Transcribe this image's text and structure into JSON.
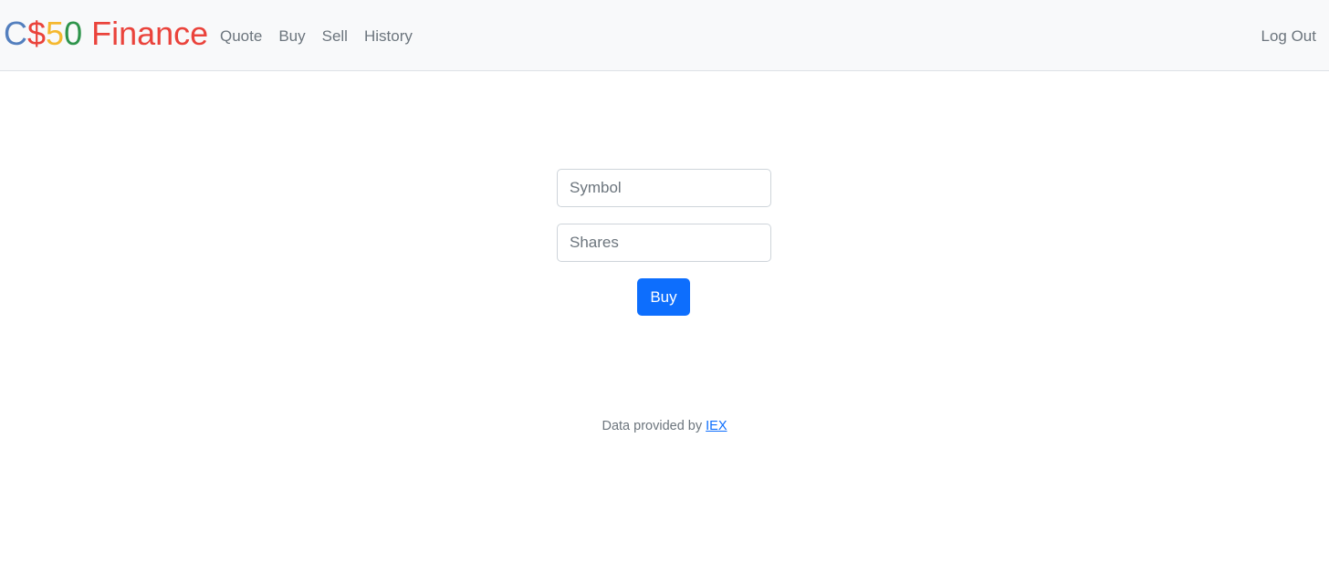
{
  "brand": {
    "c": "C",
    "dollar": "$",
    "five": "5",
    "zero": "0",
    "finance": " Finance",
    "colors": {
      "c": "#537fbe",
      "dollar": "#ea433b",
      "five": "#f5b82e",
      "zero": "#2e944b",
      "finance": "#ea433b"
    }
  },
  "nav": {
    "items": [
      {
        "label": "Quote"
      },
      {
        "label": "Buy"
      },
      {
        "label": "Sell"
      },
      {
        "label": "History"
      }
    ],
    "logout_label": "Log Out"
  },
  "form": {
    "symbol": {
      "value": "",
      "placeholder": "Symbol"
    },
    "shares": {
      "value": "",
      "placeholder": "Shares"
    },
    "submit_label": "Buy",
    "accent_color": "#0d6efd"
  },
  "footer": {
    "text": "Data provided by ",
    "link_label": "IEX"
  }
}
